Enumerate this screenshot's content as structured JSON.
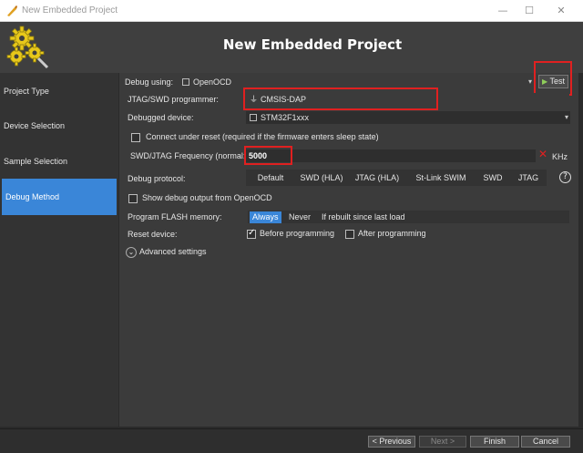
{
  "window": {
    "title": "New Embedded Project",
    "minimize": "—",
    "maximize": "☐",
    "close": "✕"
  },
  "header": {
    "heading": "New Embedded Project"
  },
  "sidebar": {
    "items": [
      {
        "label": "Project Type"
      },
      {
        "label": "Device Selection"
      },
      {
        "label": "Sample Selection"
      },
      {
        "label": "Debug Method",
        "active": true
      }
    ]
  },
  "form": {
    "debug_using_label": "Debug using:",
    "debug_using_value": "OpenOCD",
    "test_button": "Test",
    "programmer_label": "JTAG/SWD programmer:",
    "programmer_value": "CMSIS-DAP",
    "device_label": "Debugged device:",
    "device_value": "STM32F1xxx",
    "connect_under_reset": "Connect under reset (required if the firmware enters sleep state)",
    "freq_label": "SWD/JTAG Frequency (normal:",
    "freq_value": "5000",
    "freq_unit": "KHz",
    "protocol_label": "Debug protocol:",
    "protocols": [
      "Default",
      "SWD (HLA)",
      "JTAG (HLA)",
      "St-Link SWIM",
      "SWD",
      "JTAG"
    ],
    "show_debug_output": "Show debug output from OpenOCD",
    "program_flash_label": "Program FLASH memory:",
    "flash_options": [
      "Always",
      "Never",
      "If rebuilt since last load"
    ],
    "flash_selected": "Always",
    "reset_label": "Reset device:",
    "before_programming": "Before programming",
    "after_programming": "After programming",
    "advanced_settings": "Advanced settings"
  },
  "footer": {
    "previous": "< Previous",
    "next": "Next >",
    "finish": "Finish",
    "cancel": "Cancel"
  },
  "colors": {
    "accent": "#3a86d8",
    "highlight": "#e02020"
  }
}
